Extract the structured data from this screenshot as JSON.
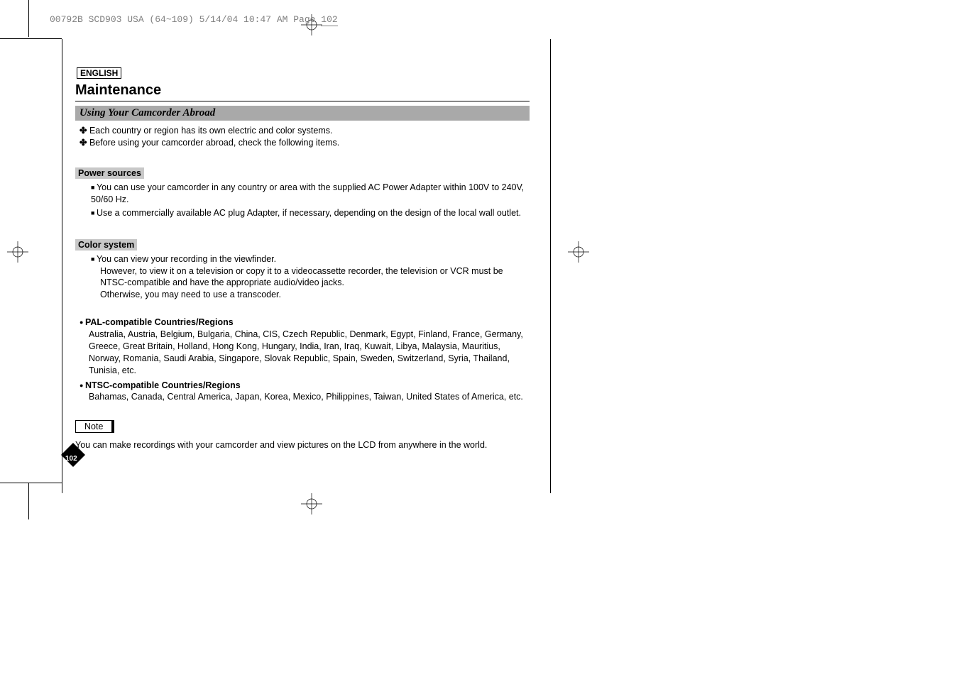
{
  "header": {
    "slug": "00792B SCD903 USA (64~109)  5/14/04 10:47 AM  Page ",
    "slug_page": "102"
  },
  "doc": {
    "language": "ENGLISH",
    "title": "Maintenance",
    "section": "Using Your Camcorder Abroad",
    "intro": [
      "Each country or region has its own electric and color systems.",
      "Before using your camcorder abroad, check the following items."
    ],
    "power": {
      "head": "Power sources",
      "items": [
        "You can use your camcorder in any country or area with the supplied AC Power Adapter within 100V to 240V, 50/60 Hz.",
        "Use a commercially available AC plug Adapter, if necessary, depending on the design of the local wall outlet."
      ]
    },
    "color": {
      "head": "Color system",
      "item_lead": "You can view your recording in the viewfinder.",
      "item_cont1": "However, to view it on a television or copy it to a videocassette recorder, the television or VCR must be NTSC-compatible and have the appropriate audio/video jacks.",
      "item_cont2": "Otherwise, you may need to use a transcoder."
    },
    "pal": {
      "head": "PAL-compatible Countries/Regions",
      "body": "Australia, Austria, Belgium, Bulgaria, China, CIS, Czech Republic, Denmark, Egypt, Finland, France, Germany, Greece, Great Britain, Holland, Hong Kong, Hungary, India, Iran, Iraq, Kuwait, Libya, Malaysia, Mauritius, Norway, Romania, Saudi Arabia, Singapore, Slovak Republic, Spain, Sweden, Switzerland, Syria, Thailand, Tunisia, etc."
    },
    "ntsc": {
      "head": "NTSC-compatible Countries/Regions",
      "body": "Bahamas, Canada, Central America, Japan, Korea, Mexico, Philippines, Taiwan, United States of America, etc."
    },
    "note_label": "Note",
    "note_text": "You can make recordings with your camcorder and view pictures on the LCD from anywhere in the world.",
    "page_number": "102"
  }
}
